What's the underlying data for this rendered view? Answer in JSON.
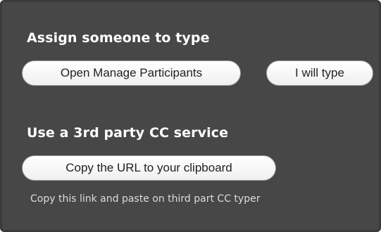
{
  "assign_section": {
    "heading": "Assign someone to type",
    "open_manage_participants_label": "Open Manage Participants",
    "i_will_type_label": "I will type"
  },
  "third_party_section": {
    "heading": "Use a 3rd party CC service",
    "copy_url_label": "Copy the URL to your clipboard",
    "hint": "Copy this link and paste on third part CC typer"
  },
  "colors": {
    "panel_background": "#474747",
    "button_background": "#ffffff",
    "heading_text": "#ffffff"
  }
}
